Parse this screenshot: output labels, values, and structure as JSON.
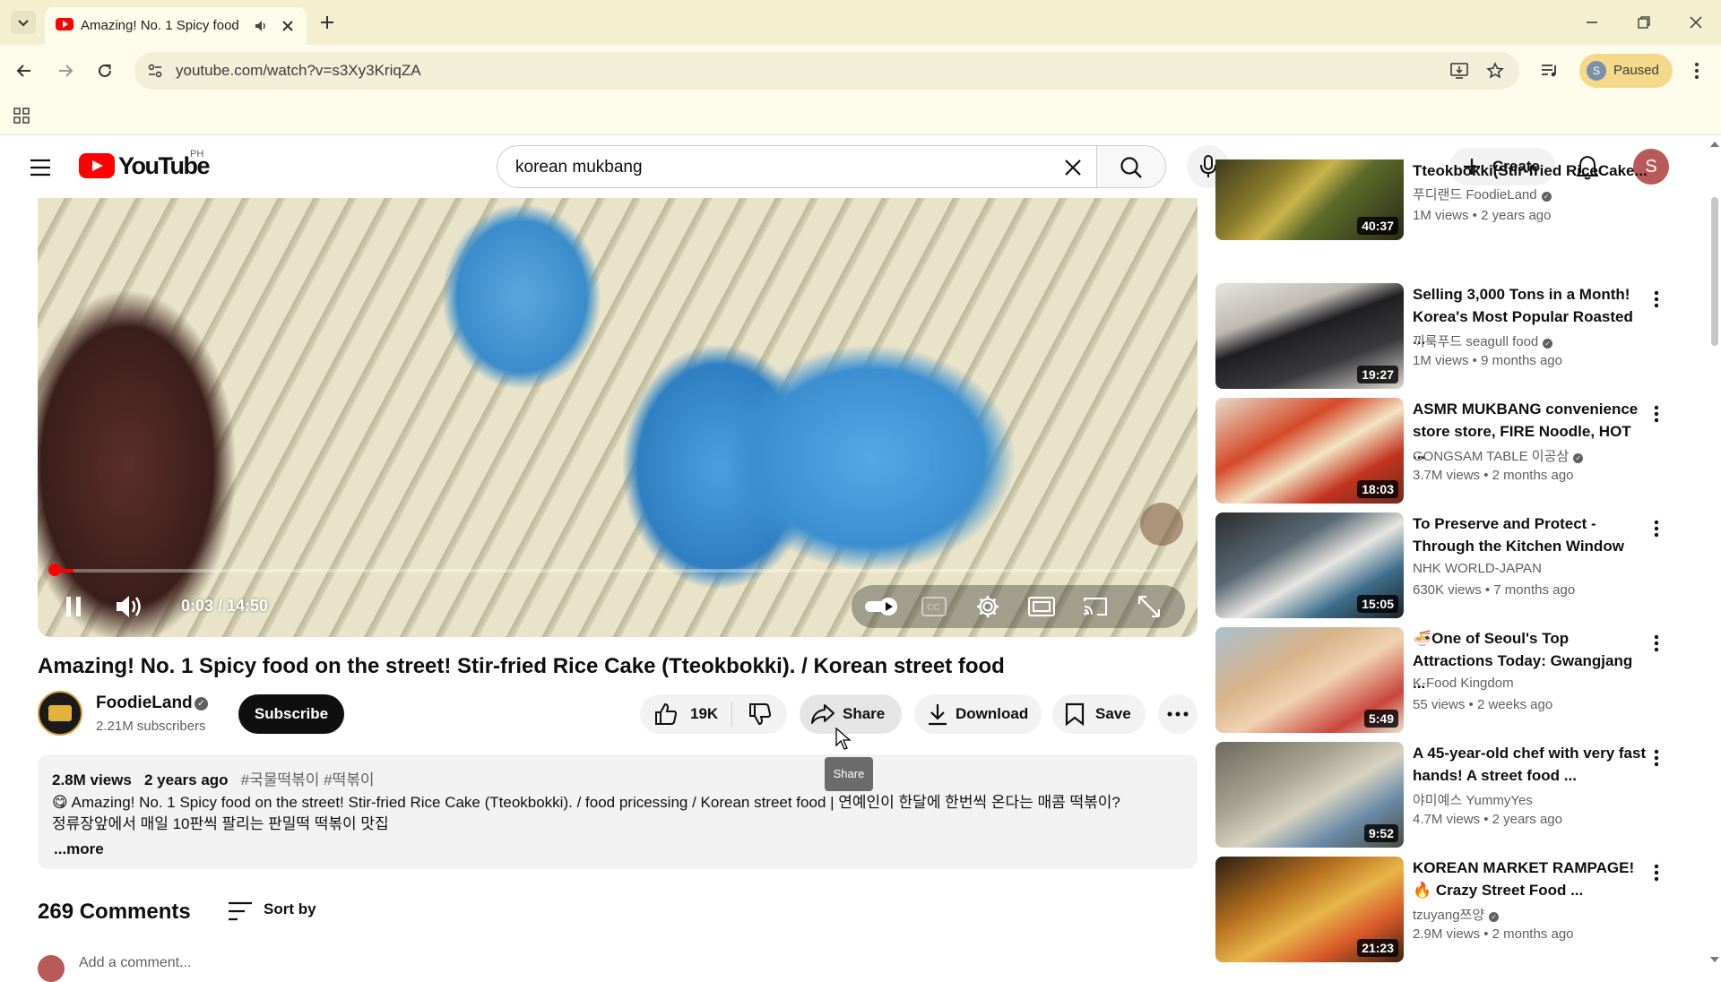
{
  "browser": {
    "tab_title": "Amazing! No. 1 Spicy food",
    "url": "youtube.com/watch?v=s3Xy3KriqZA",
    "profile_initial": "S",
    "profile_status": "Paused"
  },
  "header": {
    "logo_text": "YouTube",
    "region": "PH",
    "search_value": "korean mukbang",
    "create_label": "Create",
    "avatar_initial": "S"
  },
  "player": {
    "time": "0:03 / 14:50",
    "progress_fraction": 0.0034
  },
  "video": {
    "title": "Amazing! No. 1 Spicy food on the street! Stir-fried Rice Cake (Tteokbokki). / Korean street food",
    "channel_name": "FoodieLand",
    "subscribers": "2.21M subscribers",
    "subscribe_label": "Subscribe",
    "likes": "19K",
    "share_label": "Share",
    "download_label": "Download",
    "save_label": "Save",
    "tooltip": "Share"
  },
  "description": {
    "views": "2.8M views",
    "age": "2 years ago",
    "hashtags": "#국물떡볶이 #떡볶이",
    "line1": "😋 Amazing! No. 1 Spicy food on the street! Stir-fried Rice Cake (Tteokbokki). / food pricessing / Korean street food | 연예인이 한달에 한번씩 온다는 매콤 떡볶이?",
    "line2": "정류장앞에서 매일 10판씩 팔리는 판밀떡 떡볶이 맛집",
    "more": "...more"
  },
  "comments": {
    "count_label": "269 Comments",
    "sort_label": "Sort by",
    "add_placeholder": "Add a comment..."
  },
  "recommendations": [
    {
      "title": "Tteokbokki(Stir-fried RiceCake...",
      "channel": "푸디랜드 FoodieLand",
      "verified": true,
      "meta": "1M views • 2 years ago",
      "duration": "40:37"
    },
    {
      "title": "Selling 3,000 Tons in a Month! Korea's Most Popular Roasted ...",
      "channel": "끼룩푸드 seagull food",
      "verified": true,
      "meta": "1M views • 9 months ago",
      "duration": "19:27"
    },
    {
      "title": "ASMR MUKBANG convenience store store, FIRE Noodle, HOT ...",
      "channel": "GONGSAM TABLE 이공삼",
      "verified": true,
      "meta": "3.7M views • 2 months ago",
      "duration": "18:03"
    },
    {
      "title": "To Preserve and Protect - Through the Kitchen Window",
      "channel": "NHK WORLD-JAPAN",
      "verified": false,
      "meta": "630K views • 7 months ago",
      "duration": "15:05"
    },
    {
      "title": "🍜One of Seoul's Top Attractions Today: Gwangjang ...",
      "channel": "K-Food Kingdom",
      "verified": false,
      "meta": "55 views • 2 weeks ago",
      "duration": "5:49"
    },
    {
      "title": "A 45-year-old chef with very fast hands! A street food ...",
      "channel": "야미예스 YummyYes",
      "verified": false,
      "meta": "4.7M views • 2 years ago",
      "duration": "9:52"
    },
    {
      "title": "KOREAN MARKET RAMPAGE! 🔥 Crazy Street Food ...",
      "channel": "tzuyang쯔양",
      "verified": true,
      "meta": "2.9M views • 2 months ago",
      "duration": "21:23"
    }
  ]
}
